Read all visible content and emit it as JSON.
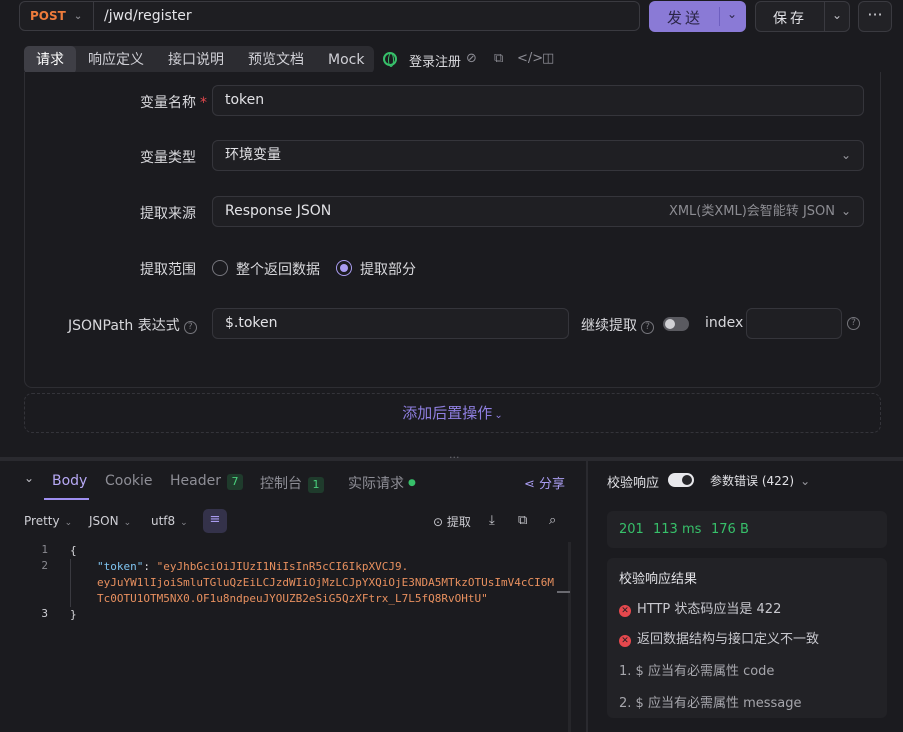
{
  "top": {
    "method": "POST",
    "url": "/jwd/register",
    "send_label": "发送",
    "save_label": "保存",
    "more": "···"
  },
  "tabs": [
    {
      "label": "请求"
    },
    {
      "label": "响应定义"
    },
    {
      "label": "接口说明"
    },
    {
      "label": "预览文档"
    },
    {
      "label": "Mock"
    }
  ],
  "env_name": "登录注册",
  "form": {
    "var_name_label": "变量名称",
    "required_mark": "*",
    "var_name_value": "token",
    "var_type_label": "变量类型",
    "var_type_value": "环境变量",
    "source_label": "提取来源",
    "source_value": "Response JSON",
    "source_hint": "XML(类XML)会智能转 JSON",
    "range_label": "提取范围",
    "range_opt_all": "整个返回数据",
    "range_opt_part": "提取部分",
    "jsonpath_label": "JSONPath 表达式",
    "jsonpath_value": "$.token",
    "continue_label": "继续提取",
    "index_label": "index",
    "index_value": ""
  },
  "add_post_op": "添加后置操作",
  "response": {
    "tabs": {
      "body": "Body",
      "cookie": "Cookie",
      "header": "Header",
      "header_count": "7",
      "console": "控制台",
      "console_count": "1",
      "actual": "实际请求"
    },
    "share": "分享",
    "toolbar": {
      "pretty": "Pretty",
      "json": "JSON",
      "utf8": "utf8",
      "extract": "提取"
    },
    "code": {
      "l1": "{",
      "key": "\"token\"",
      "colon": ": ",
      "val1": "\"eyJhbGciOiJIUzI1NiIsInR5cCI6IkpXVCJ9.",
      "val2": "eyJuYW1lIjoiSmluTGluQzEiLCJzdWIiOjMzLCJpYXQiOjE3NDA5MTkzOTUsImV4cCI6M",
      "val3": "Tc0OTU1OTM5NX0.OF1u8ndpeuJYOUZB2eSiG5QzXFtrx_L7L5fQ8RvOHtU\"",
      "l3": "}",
      "ln1": "1",
      "ln2": "2",
      "ln3": "3"
    }
  },
  "validation": {
    "label": "校验响应",
    "schema": "参数错误 (422)",
    "status": "201",
    "time": "113 ms",
    "size": "176 B",
    "result_title": "校验响应结果",
    "err1": "HTTP 状态码应当是 422",
    "err2": "返回数据结构与接口定义不一致",
    "item1": "1. $ 应当有必需属性 code",
    "item2": "2. $ 应当有必需属性 message"
  },
  "colors": {
    "accent": "#8a7ad6",
    "method": "#ee7b3b",
    "success": "#37c06a",
    "error": "#e5484d"
  }
}
